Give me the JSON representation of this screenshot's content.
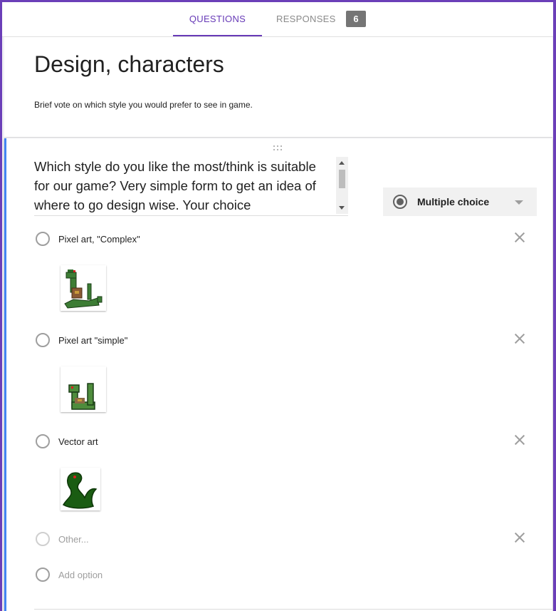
{
  "tabs": {
    "questions_label": "QUESTIONS",
    "responses_label": "RESPONSES",
    "responses_count": "6"
  },
  "form": {
    "title": "Design, characters",
    "description": "Brief vote on which style you would prefer to see in game."
  },
  "question": {
    "text": "Which style do you like the most/think is suitable for our game? Very simple form to get an idea of where to go design wise. Your choice",
    "type_label": "Multiple choice",
    "type_icon": "radio-button-icon",
    "options": [
      {
        "label": "Pixel art, \"Complex\"",
        "image_icon": "pixel-snake-complex-image"
      },
      {
        "label": "Pixel art \"simple\"",
        "image_icon": "pixel-snake-simple-image"
      },
      {
        "label": "Vector art",
        "image_icon": "vector-snake-image"
      }
    ],
    "other_label": "Other...",
    "add_option_label": "Add option"
  },
  "colors": {
    "accent": "#673ab7",
    "question_accent": "#4285f4",
    "snake_green": "#2e6b2a",
    "vector_green": "#1a5c12"
  }
}
